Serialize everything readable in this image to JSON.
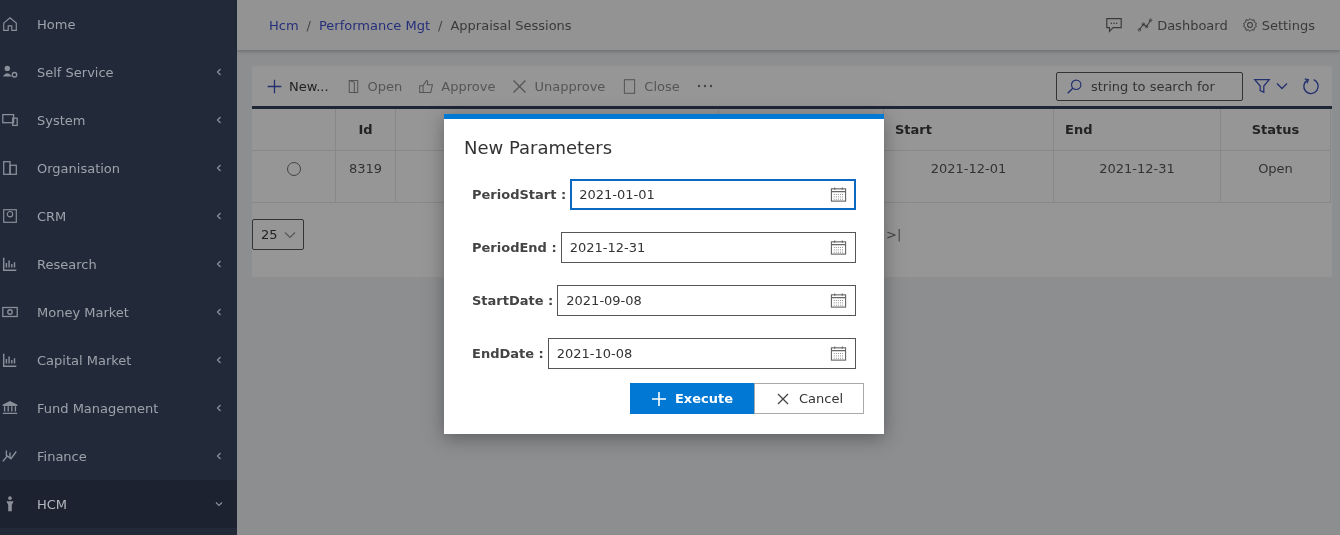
{
  "sidebar": {
    "items": [
      {
        "label": "Home",
        "kind": "link",
        "expanded": false
      },
      {
        "label": "Self Service",
        "kind": "group",
        "expanded": false
      },
      {
        "label": "System",
        "kind": "group",
        "expanded": false
      },
      {
        "label": "Organisation",
        "kind": "group",
        "expanded": false
      },
      {
        "label": "CRM",
        "kind": "group",
        "expanded": false
      },
      {
        "label": "Research",
        "kind": "group",
        "expanded": false
      },
      {
        "label": "Money Market",
        "kind": "group",
        "expanded": false
      },
      {
        "label": "Capital Market",
        "kind": "group",
        "expanded": false
      },
      {
        "label": "Fund Management",
        "kind": "group",
        "expanded": false
      },
      {
        "label": "Finance",
        "kind": "group",
        "expanded": false
      },
      {
        "label": "HCM",
        "kind": "group",
        "expanded": true
      }
    ]
  },
  "breadcrumb": [
    {
      "label": "Hcm",
      "kind": "link"
    },
    {
      "label": "/",
      "kind": "separator"
    },
    {
      "label": "Performance Mgt",
      "kind": "link"
    },
    {
      "label": "/",
      "kind": "separator"
    },
    {
      "label": "Appraisal Sessions",
      "kind": "current"
    }
  ],
  "header_actions": [
    {
      "kind": "chat"
    },
    {
      "label": "Dashboard",
      "kind": "dashboard"
    },
    {
      "label": "Settings",
      "kind": "settings"
    }
  ],
  "toolbar": [
    {
      "label": "New...",
      "disabled": false
    },
    {
      "label": "Open",
      "disabled": true
    },
    {
      "label": "Approve",
      "disabled": true
    },
    {
      "label": "Unapprove",
      "disabled": true
    },
    {
      "label": "Close",
      "disabled": true
    }
  ],
  "search": {
    "placeholder": "string to search for"
  },
  "table": {
    "columns": [
      "",
      "Id",
      "",
      "",
      "Start",
      "End",
      "Status"
    ],
    "rows": [
      {
        "selected": false,
        "cells": [
          "",
          "8319",
          "",
          "",
          "2021-12-01",
          "2021-12-31",
          "Open"
        ]
      }
    ]
  },
  "pager": {
    "page_size": "25",
    "last": ">|"
  },
  "dialog": {
    "title": "New Parameters",
    "fields": [
      {
        "label": "PeriodStart :",
        "value": "2021-01-01",
        "focused": true
      },
      {
        "label": "PeriodEnd :",
        "value": "2021-12-31",
        "focused": false
      },
      {
        "label": "StartDate :",
        "value": "2021-09-08",
        "focused": false
      },
      {
        "label": "EndDate :",
        "value": "2021-10-08",
        "focused": false
      }
    ],
    "buttons": [
      {
        "label": "Execute",
        "kind": "primary"
      },
      {
        "label": "Cancel",
        "kind": "secondary"
      }
    ]
  }
}
